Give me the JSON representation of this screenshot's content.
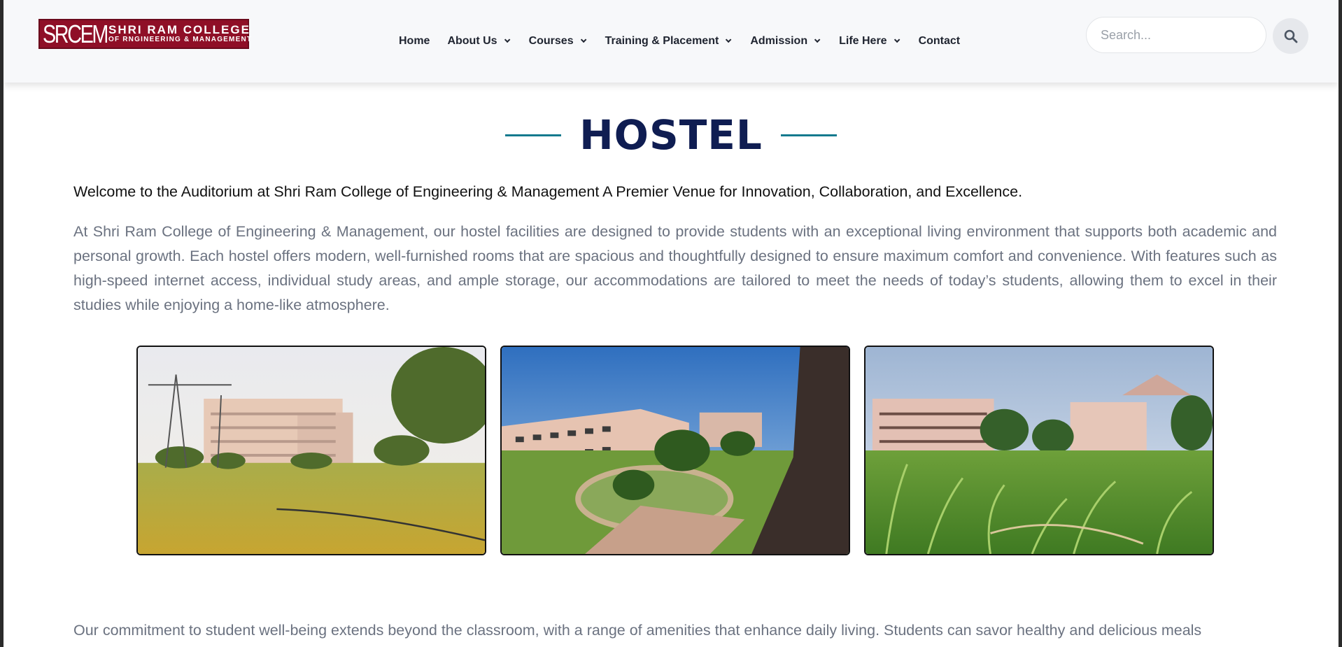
{
  "header": {
    "logo_mark": "SRCEM",
    "logo_line1": "SHRI RAM COLLEGE",
    "logo_line2": "OF RNGINEERING & MANAGEMENT",
    "brand_color": "#8f0f27",
    "nav": [
      {
        "label": "Home",
        "has_dropdown": false
      },
      {
        "label": "About Us",
        "has_dropdown": true
      },
      {
        "label": "Courses",
        "has_dropdown": true
      },
      {
        "label": "Training & Placement",
        "has_dropdown": true
      },
      {
        "label": "Admission",
        "has_dropdown": true
      },
      {
        "label": "Life Here",
        "has_dropdown": true
      },
      {
        "label": "Contact",
        "has_dropdown": false
      }
    ],
    "search": {
      "placeholder": "Search...",
      "value": "",
      "icon": "search-icon"
    }
  },
  "main": {
    "title": "HOSTEL",
    "accent_color": "#147a8e",
    "title_color": "#0f1d52",
    "welcome": "Welcome to the Auditorium at Shri Ram College of Engineering & Management A Premier Venue for Innovation, Collaboration, and Excellence.",
    "paragraph1": "At Shri Ram College of Engineering & Management, our hostel facilities are designed to provide students with an exceptional living environment that supports both academic and personal growth. Each hostel offers modern, well-furnished rooms that are spacious and thoughtfully designed to ensure maximum comfort and convenience. With features such as high-speed internet access, individual study areas, and ample storage, our accommodations are tailored to meet the needs of today’s students, allowing them to excel in their studies while enjoying a home-like atmosphere.",
    "paragraph2": "Our commitment to student well-being extends beyond the classroom, with a range of amenities that enhance daily living. Students can savor healthy and delicious meals",
    "gallery": [
      "campus-lawn-photo",
      "hostel-courtyard-photo",
      "hostel-grass-photo"
    ]
  }
}
